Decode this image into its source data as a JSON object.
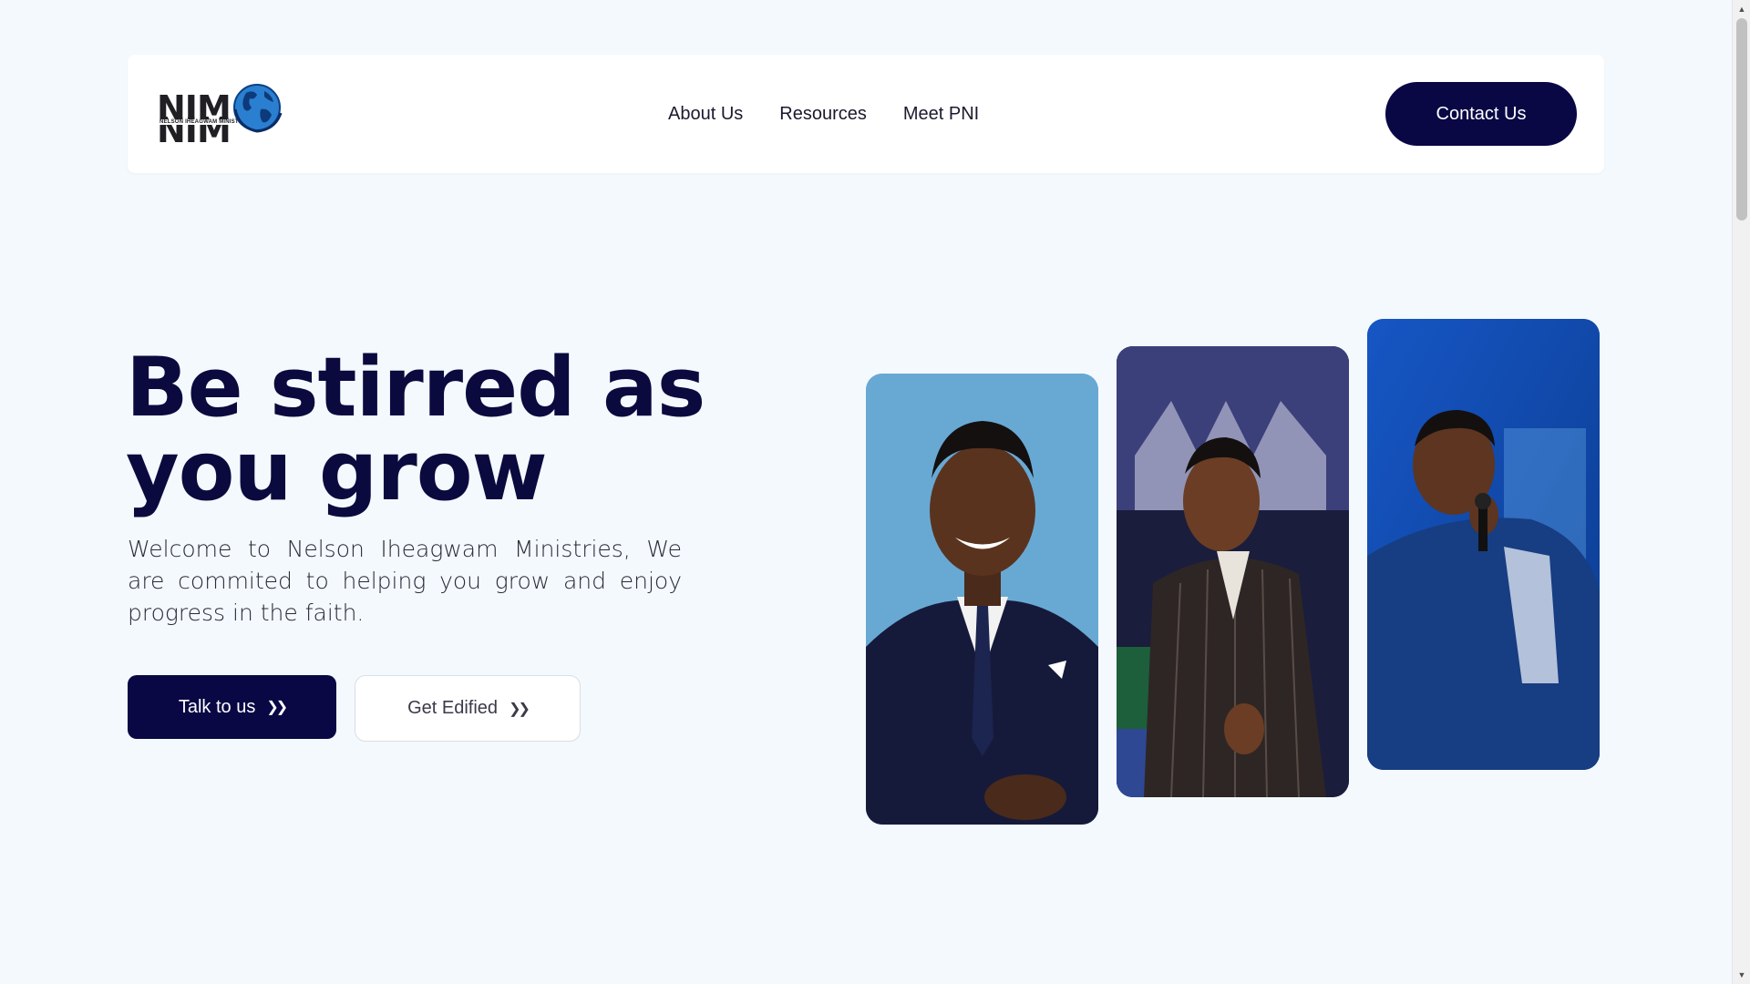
{
  "logo": {
    "text_top": "NIM",
    "text_bottom": "NIM",
    "subtitle": "NELSON IHEAGWAM MINISTRIES",
    "icon": "globe-icon"
  },
  "nav": {
    "links": [
      {
        "label": "About Us"
      },
      {
        "label": "Resources"
      },
      {
        "label": "Meet PNI"
      }
    ],
    "contact_label": "Contact Us"
  },
  "hero": {
    "title_line1": "Be stirred as",
    "title_line2": "you grow",
    "description": "Welcome to Nelson Iheagwam Ministries, We are commited to helping you grow and enjoy progress in the faith.",
    "primary_button": "Talk to us",
    "secondary_button": "Get Edified",
    "button_icon": "double-chevron-right-icon"
  },
  "colors": {
    "brand_navy": "#090845",
    "background": "#f4f9fd",
    "card_white": "#ffffff"
  },
  "photos": [
    {
      "icon": "portrait-photo"
    },
    {
      "icon": "preaching-photo"
    },
    {
      "icon": "worship-singing-photo"
    }
  ]
}
